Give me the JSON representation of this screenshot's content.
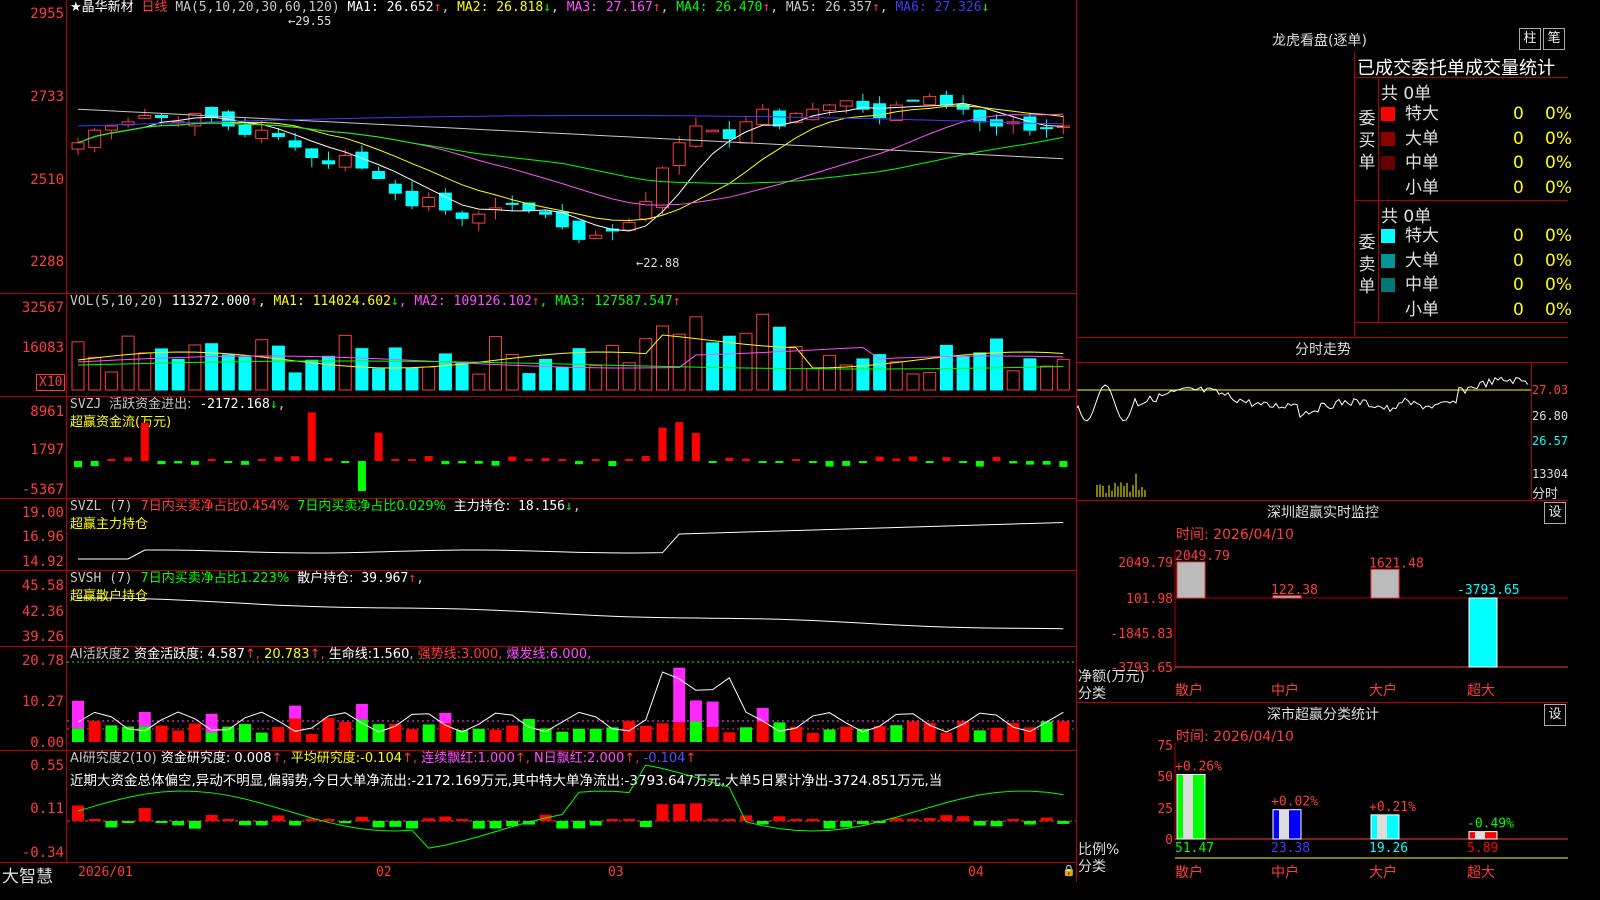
{
  "app": {
    "logo": "大智慧"
  },
  "stock": {
    "name": "★晶华新材",
    "period": "日线"
  },
  "main_chart": {
    "ma_label": "MA(5,10,20,30,60,120)",
    "ma": [
      {
        "label": "MA1:",
        "value": "26.652",
        "arrow": "↑",
        "color": "#ffffff"
      },
      {
        "label": "MA2:",
        "value": "26.818",
        "arrow": "↓",
        "color": "#ffff00"
      },
      {
        "label": "MA3:",
        "value": "27.167",
        "arrow": "↑",
        "color": "#ff50ff"
      },
      {
        "label": "MA4:",
        "value": "26.470",
        "arrow": "↑",
        "color": "#00ff00"
      },
      {
        "label": "MA5:",
        "value": "26.357",
        "arrow": "↑",
        "color": "#c8c8c8"
      },
      {
        "label": "MA6:",
        "value": "27.326",
        "arrow": "↓",
        "color": "#3c3cff"
      }
    ],
    "y_ticks": [
      "2955",
      "2733",
      "2510",
      "2288"
    ],
    "high_label": "←29.55",
    "low_label": "←22.88"
  },
  "vol": {
    "title": "VOL(5,10,20)",
    "value": "113272.000",
    "arrow": "↑",
    "ma": [
      {
        "label": "MA1:",
        "value": "114024.602",
        "arrow": "↓",
        "color": "#ffff00"
      },
      {
        "label": "MA2:",
        "value": "109126.102",
        "arrow": "↑",
        "color": "#ff50ff"
      },
      {
        "label": "MA3:",
        "value": "127587.547",
        "arrow": "↑",
        "color": "#00ff00"
      }
    ],
    "y_ticks": [
      "32567",
      "16083"
    ],
    "unit": "X10"
  },
  "svzj": {
    "title": "SVZJ",
    "label": "活跃资金进出:",
    "value": "-2172.168",
    "arrow": "↓",
    "sub": "超赢资金流(万元)",
    "y_ticks": [
      "8961",
      "1797",
      "-5367"
    ]
  },
  "svzl": {
    "title": "SVZL (7)",
    "t1": "7日内买卖净占比0.454%",
    "t2": "7日内买卖净占比0.029%",
    "t3": "主力持仓:",
    "v3": "18.156",
    "arrow": "↓",
    "sub": "超赢主力持仓",
    "y_ticks": [
      "19.00",
      "16.96",
      "14.92"
    ]
  },
  "svsh": {
    "title": "SVSH (7)",
    "t1": "7日内买卖净占比1.223%",
    "t2": "散户持仓:",
    "v2": "39.967",
    "arrow": "↑",
    "sub": "超赢散户持仓",
    "y_ticks": [
      "45.58",
      "42.36",
      "39.26"
    ]
  },
  "ai1": {
    "title": "AI活跃度2",
    "label": "资金活跃度:",
    "v1": "4.587",
    "v2": "20.783",
    "l3": "生命线:",
    "v3": "1.560",
    "l4": "强势线:",
    "v4": "3.000",
    "l5": "爆发线:",
    "v5": "6.000",
    "y_ticks": [
      "20.78",
      "10.27",
      "0.00"
    ]
  },
  "ai2": {
    "title": "AI研究度2(10)",
    "label": "资金研究度:",
    "v1": "0.008",
    "l2": "平均研究度:",
    "v2": "-0.104",
    "l3": "连续飘红:",
    "v3": "1.000",
    "l4": "N日飘红:",
    "v4": "2.000",
    "v5": "-0.104",
    "text": "近期大资金总体偏空,异动不明显,偏弱势,今日大单净流出:-2172.169万元,其中特大单净流出:-3793.647万元,大单5日累计净出-3724.851万元,当",
    "y_ticks": [
      "0.55",
      "0.11",
      "-0.34"
    ]
  },
  "x_axis": [
    "2026/01",
    "02",
    "03",
    "04"
  ],
  "dragon": {
    "title": "龙虎看盘(逐单)",
    "btn1": "柱",
    "btn2": "笔",
    "header": "已成交委托单成交量统计",
    "buy_label": "委买单",
    "sell_label": "委卖单",
    "buy_total": "共 0单",
    "sell_total": "共 0单",
    "buy_rows": [
      {
        "name": "特大",
        "v": "0",
        "p": "0%",
        "color": "#ff0000"
      },
      {
        "name": "大单",
        "v": "0",
        "p": "0%",
        "color": "#8c0000"
      },
      {
        "name": "中单",
        "v": "0",
        "p": "0%",
        "color": "#640000"
      },
      {
        "name": "小单",
        "v": "0",
        "p": "0%",
        "color": "#000000"
      }
    ],
    "sell_rows": [
      {
        "name": "特大",
        "v": "0",
        "p": "0%",
        "color": "#00ffff"
      },
      {
        "name": "大单",
        "v": "0",
        "p": "0%",
        "color": "#009696"
      },
      {
        "name": "中单",
        "v": "0",
        "p": "0%",
        "color": "#007878"
      },
      {
        "name": "小单",
        "v": "0",
        "p": "0%",
        "color": "#000000"
      }
    ]
  },
  "intraday": {
    "title": "分时走势",
    "prices": [
      "27.03",
      "26.80",
      "26.57"
    ],
    "vol": "13304",
    "vol_label": "分时"
  },
  "sz_monitor": {
    "title": "深圳超赢实时监控",
    "btn": "设",
    "time": "时间: 2026/04/10",
    "y_ticks": [
      "2049.79",
      "101.98",
      "-1845.83",
      "-3793.65"
    ],
    "ylabel": "净额(万元)",
    "xlabel": "分类",
    "cats": [
      "散户",
      "中户",
      "大户",
      "超大"
    ],
    "values": [
      2049.79,
      122.38,
      1621.48,
      -3793.65
    ],
    "value_labels": [
      "2049.79",
      "122.38",
      "1621.48",
      "-3793.65"
    ]
  },
  "sz_class": {
    "title": "深市超赢分类统计",
    "btn": "设",
    "time": "时间: 2026/04/10",
    "y_ticks": [
      "75",
      "50",
      "25",
      "0"
    ],
    "ylabel": "比例%",
    "xlabel": "分类",
    "cats": [
      "散户",
      "中户",
      "大户",
      "超大"
    ],
    "values": [
      51.47,
      23.38,
      19.26,
      5.89
    ],
    "changes": [
      "+0.26%",
      "+0.02%",
      "+0.21%",
      "-0.49%"
    ]
  }
}
